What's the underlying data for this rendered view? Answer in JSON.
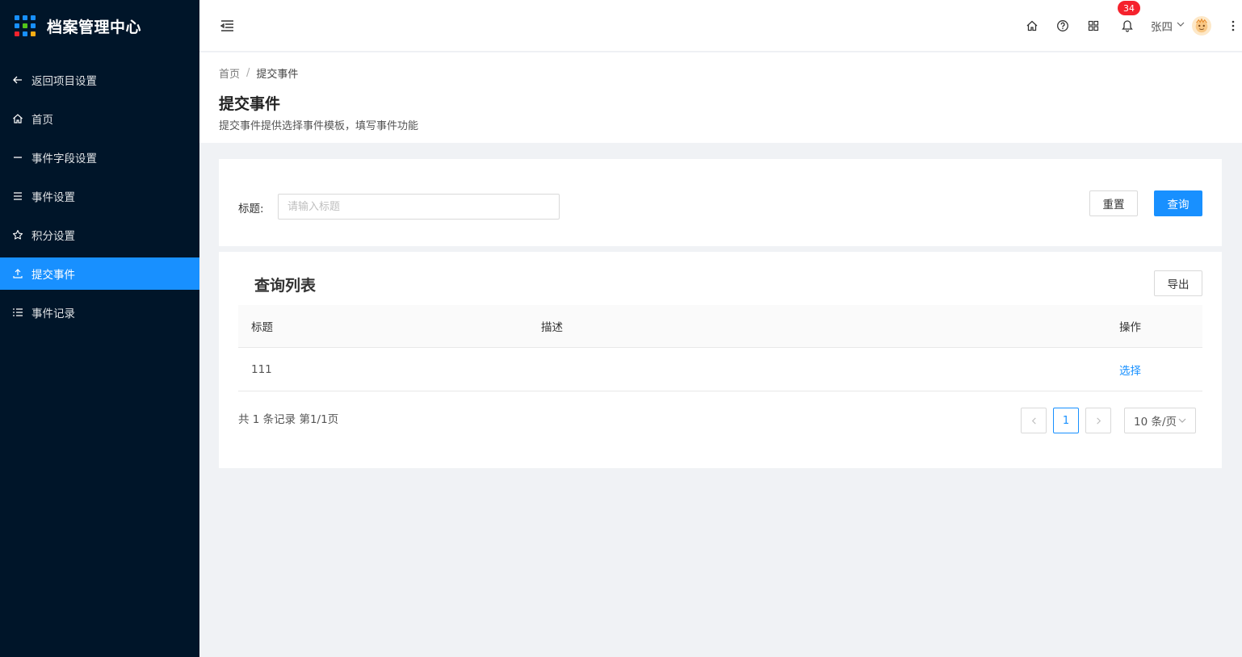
{
  "brand": {
    "title": "档案管理中心",
    "logo_colors": [
      "#1890ff",
      "#1890ff",
      "#1890ff",
      "#1890ff",
      "#52c41a",
      "#1890ff",
      "#f5222d",
      "#1890ff",
      "#faad14"
    ]
  },
  "sidebar": {
    "items": [
      {
        "label": "返回项目设置",
        "icon": "arrow-left-icon"
      },
      {
        "label": "首页",
        "icon": "home-icon"
      },
      {
        "label": "事件字段设置",
        "icon": "minus-icon"
      },
      {
        "label": "事件设置",
        "icon": "menu-icon"
      },
      {
        "label": "积分设置",
        "icon": "star-icon"
      },
      {
        "label": "提交事件",
        "icon": "upload-icon",
        "active": true
      },
      {
        "label": "事件记录",
        "icon": "list-icon"
      }
    ]
  },
  "topbar": {
    "notification_count": "34",
    "user_name": "张四"
  },
  "breadcrumb": {
    "home": "首页",
    "separator": "/",
    "current": "提交事件"
  },
  "page": {
    "title": "提交事件",
    "description": "提交事件提供选择事件模板，填写事件功能"
  },
  "search": {
    "label": "标题:",
    "placeholder": "请输入标题",
    "value": "",
    "reset_label": "重置",
    "query_label": "查询"
  },
  "list": {
    "title": "查询列表",
    "export_label": "导出",
    "columns": {
      "title": "标题",
      "description": "描述",
      "operation": "操作"
    },
    "rows": [
      {
        "title": "111",
        "description": "",
        "action": "选择"
      }
    ],
    "total_text": "共 1 条记录 第1/1页",
    "current_page": "1",
    "page_size": "10 条/页"
  },
  "colors": {
    "sidebar_bg": "#001529",
    "accent": "#1890ff"
  }
}
